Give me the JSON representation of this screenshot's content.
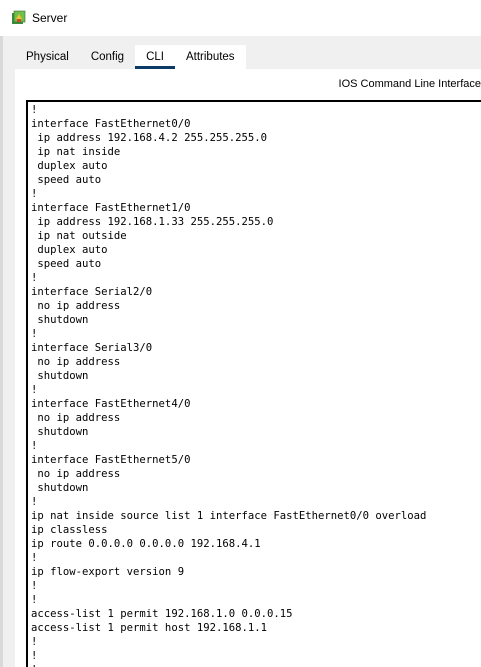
{
  "window": {
    "title": "Server",
    "app_icon": "packet-tracer-server-icon"
  },
  "tabs": [
    {
      "label": "Physical",
      "active": false
    },
    {
      "label": "Config",
      "active": false
    },
    {
      "label": "CLI",
      "active": true
    },
    {
      "label": "Attributes",
      "active": false
    }
  ],
  "cli": {
    "heading": "IOS Command Line Interface",
    "accent_color": "#0b3a66",
    "output": "!\ninterface FastEthernet0/0\n ip address 192.168.4.2 255.255.255.0\n ip nat inside\n duplex auto\n speed auto\n!\ninterface FastEthernet1/0\n ip address 192.168.1.33 255.255.255.0\n ip nat outside\n duplex auto\n speed auto\n!\ninterface Serial2/0\n no ip address\n shutdown\n!\ninterface Serial3/0\n no ip address\n shutdown\n!\ninterface FastEthernet4/0\n no ip address\n shutdown\n!\ninterface FastEthernet5/0\n no ip address\n shutdown\n!\nip nat inside source list 1 interface FastEthernet0/0 overload\nip classless\nip route 0.0.0.0 0.0.0.0 192.168.4.1\n!\nip flow-export version 9\n!\n!\naccess-list 1 permit 192.168.1.0 0.0.0.15\naccess-list 1 permit host 192.168.1.1\n!\n!\n!"
  }
}
